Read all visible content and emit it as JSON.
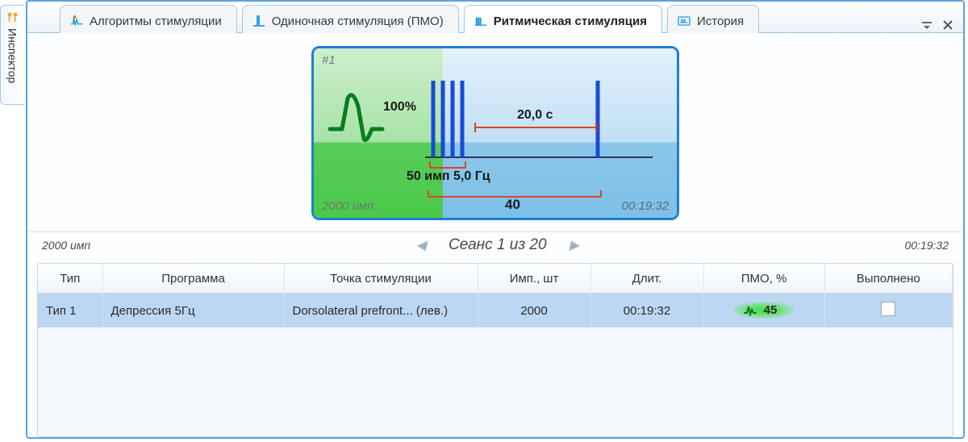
{
  "inspector": {
    "label": "Инспектор"
  },
  "tabs": [
    {
      "label": "Алгоритмы стимуляции"
    },
    {
      "label": "Одиночная стимуляция (ПМО)"
    },
    {
      "label": "Ритмическая стимуляция"
    },
    {
      "label": "История"
    }
  ],
  "diagram": {
    "id_label": "#1",
    "amplitude_pct": "100%",
    "interval_label": "20,0 с",
    "pulses_label": "50 имп 5,0 Гц",
    "total_pulses": "2000 имп",
    "trains": "40",
    "total_time": "00:19:32"
  },
  "session": {
    "total_pulses": "2000 имп",
    "label": "Сеанс 1 из 20",
    "duration": "00:19:32"
  },
  "table": {
    "headers": {
      "type": "Тип",
      "program": "Программа",
      "point": "Точка стимуляции",
      "pulses": "Имп., шт",
      "duration": "Длит.",
      "pmo": "ПМО, %",
      "done": "Выполнено"
    },
    "rows": [
      {
        "type": "Тип 1",
        "program": "Депрессия 5Гц",
        "point": "Dorsolateral prefront...  (лев.)",
        "pulses": "2000",
        "duration": "00:19:32",
        "pmo": "45",
        "done": false
      }
    ]
  }
}
